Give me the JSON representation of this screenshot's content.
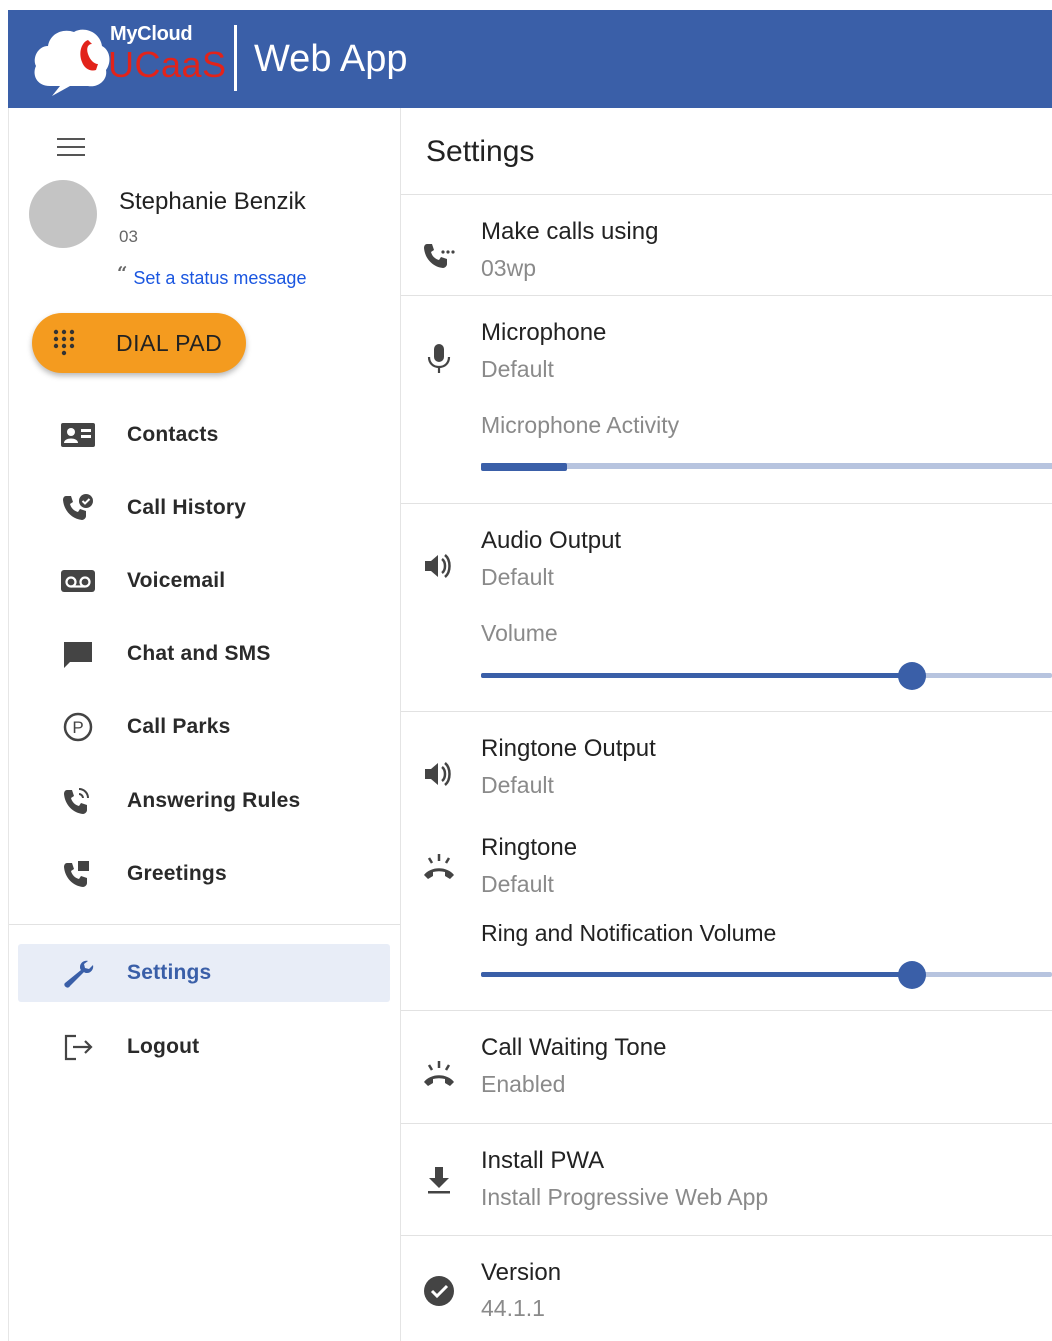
{
  "header": {
    "logo_top": "MyCloud",
    "logo_bottom": "UCaaS",
    "app_title": "Web App"
  },
  "user": {
    "name": "Stephanie Benzik",
    "extension": "03",
    "status_link": "Set a status message"
  },
  "dial_pad": {
    "label": "DIAL PAD"
  },
  "nav": {
    "items": [
      {
        "label": "Contacts",
        "icon": "contacts-icon"
      },
      {
        "label": "Call History",
        "icon": "call-history-icon"
      },
      {
        "label": "Voicemail",
        "icon": "voicemail-icon"
      },
      {
        "label": "Chat and SMS",
        "icon": "chat-icon"
      },
      {
        "label": "Call Parks",
        "icon": "call-park-icon"
      },
      {
        "label": "Answering Rules",
        "icon": "answering-rules-icon"
      },
      {
        "label": "Greetings",
        "icon": "greetings-icon"
      }
    ],
    "settings": "Settings",
    "logout": "Logout"
  },
  "settings": {
    "title": "Settings",
    "make_calls": {
      "title": "Make calls using",
      "value": "03wp"
    },
    "microphone": {
      "title": "Microphone",
      "value": "Default",
      "activity_label": "Microphone Activity",
      "activity_level": 0.15
    },
    "audio_output": {
      "title": "Audio Output",
      "value": "Default",
      "volume_label": "Volume",
      "volume_level": 0.754
    },
    "ringtone_output": {
      "title": "Ringtone Output",
      "value": "Default"
    },
    "ringtone": {
      "title": "Ringtone",
      "value": "Default",
      "ring_volume_label": "Ring and Notification Volume",
      "ring_volume_level": 0.754
    },
    "call_waiting": {
      "title": "Call Waiting Tone",
      "value": "Enabled"
    },
    "install_pwa": {
      "title": "Install PWA",
      "value": "Install Progressive Web App"
    },
    "version": {
      "title": "Version",
      "value": "44.1.1"
    }
  },
  "colors": {
    "header_bg": "#3a5fa8",
    "accent": "#3a5fa8",
    "dial_pad": "#f49b1f",
    "logo_red": "#e2231a",
    "link": "#1a56e0"
  }
}
